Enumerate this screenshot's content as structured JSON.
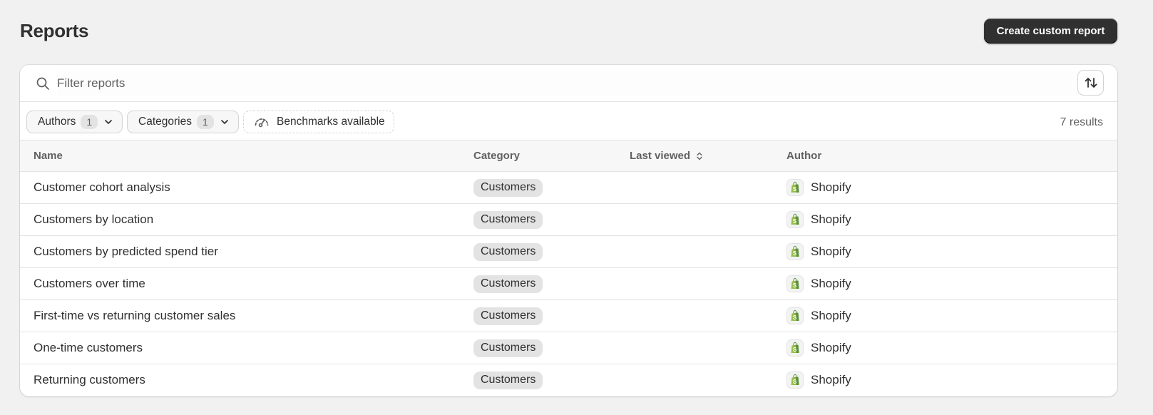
{
  "page": {
    "title": "Reports"
  },
  "actions": {
    "create_label": "Create custom report"
  },
  "search": {
    "placeholder": "Filter reports",
    "value": ""
  },
  "filters": {
    "authors": {
      "label": "Authors",
      "count": "1"
    },
    "categories": {
      "label": "Categories",
      "count": "1"
    },
    "benchmarks": {
      "label": "Benchmarks available"
    },
    "results": "7 results"
  },
  "table": {
    "headers": {
      "name": "Name",
      "category": "Category",
      "last_viewed": "Last viewed",
      "author": "Author"
    },
    "rows": [
      {
        "name": "Customer cohort analysis",
        "category": "Customers",
        "last_viewed": "",
        "author": "Shopify"
      },
      {
        "name": "Customers by location",
        "category": "Customers",
        "last_viewed": "",
        "author": "Shopify"
      },
      {
        "name": "Customers by predicted spend tier",
        "category": "Customers",
        "last_viewed": "",
        "author": "Shopify"
      },
      {
        "name": "Customers over time",
        "category": "Customers",
        "last_viewed": "",
        "author": "Shopify"
      },
      {
        "name": "First-time vs returning customer sales",
        "category": "Customers",
        "last_viewed": "",
        "author": "Shopify"
      },
      {
        "name": "One-time customers",
        "category": "Customers",
        "last_viewed": "",
        "author": "Shopify"
      },
      {
        "name": "Returning customers",
        "category": "Customers",
        "last_viewed": "",
        "author": "Shopify"
      }
    ]
  },
  "icons": {
    "search": "search-icon",
    "sort": "sort-arrows-icon",
    "chevron": "chevron-down-icon",
    "benchmark": "gauge-icon",
    "author_logo": "shopify-logo-icon",
    "sort_indicator": "sort-indicator-icon"
  },
  "colors": {
    "primary_button": "#303030",
    "background": "#f1f1f1",
    "shopify_green": "#95bf47"
  }
}
